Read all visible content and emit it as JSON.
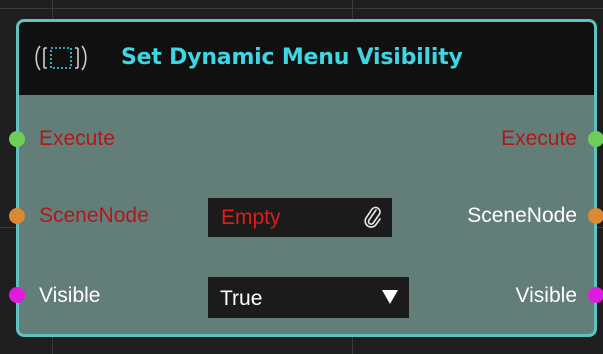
{
  "node": {
    "title": "Set Dynamic Menu Visibility",
    "icon": "dynamic-menu-icon",
    "accent_color": "#5fc2c0",
    "title_color": "#3ed6e2",
    "inputs": [
      {
        "label": "Execute",
        "pin_color": "#6ccd59"
      },
      {
        "label": "SceneNode",
        "pin_color": "#d98a32"
      },
      {
        "label": "Visible",
        "pin_color": "#e01be0"
      }
    ],
    "outputs": [
      {
        "label": "Execute",
        "pin_color": "#6ccd59"
      },
      {
        "label": "SceneNode",
        "pin_color": "#d98a32"
      },
      {
        "label": "Visible",
        "pin_color": "#e01be0"
      }
    ],
    "scene_node_field": {
      "value": "Empty",
      "icon": "paperclip-icon"
    },
    "visible_dropdown": {
      "selected": "True",
      "icon": "triangle-down-icon"
    }
  }
}
